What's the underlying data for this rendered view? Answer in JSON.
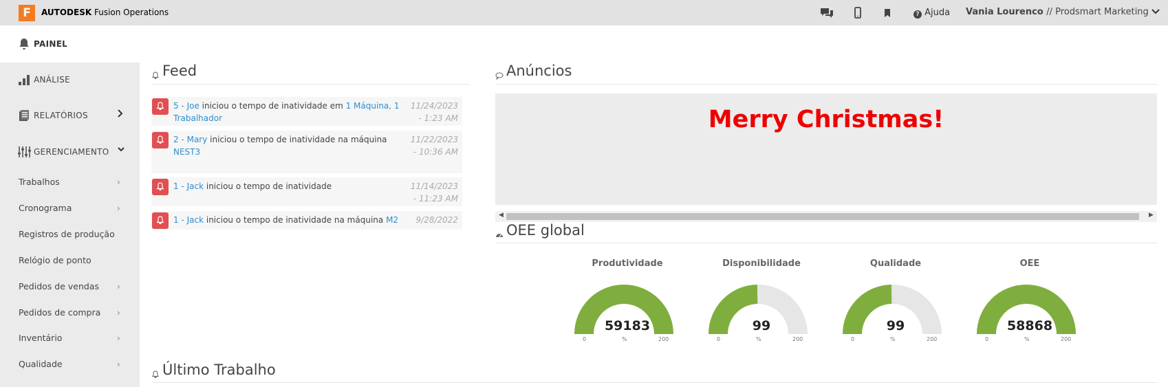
{
  "topbar": {
    "logo_letter": "F",
    "brand_bold": "AUTODESK",
    "brand_rest": "Fusion Operations",
    "help_label": "Ajuda",
    "user_name": "Vania Lourenco",
    "user_org": "// Prodsmart Marketing",
    "icons": [
      "chat-icon",
      "mobile-icon",
      "bookmark-icon",
      "help-icon",
      "chevron-down-icon"
    ]
  },
  "sidebar": {
    "painel": "PAINEL",
    "analise": "ANÁLISE",
    "relatorios": "RELATÓRIOS",
    "gerenciamento": "GERENCIAMENTO",
    "sub_items": [
      "Trabalhos",
      "Cronograma",
      "Registros de produção",
      "Relógio de ponto",
      "Pedidos de vendas",
      "Pedidos de compra",
      "Inventário",
      "Qualidade"
    ]
  },
  "feed": {
    "title": "Feed",
    "items": [
      {
        "link1": "5 - Joe",
        "text": " iniciou o tempo de inatividade em ",
        "link2": "1 Máquina, 1 Trabalhador",
        "date": "11/24/2023 - 1:23 AM"
      },
      {
        "link1": "2 - Mary",
        "text": " iniciou o tempo de inatividade na máquina ",
        "link2": "NEST3",
        "date": "11/22/2023 - 10:36 AM"
      },
      {
        "link1": "1 - Jack",
        "text": " iniciou o tempo de inatividade",
        "link2": "",
        "date": "11/14/2023 - 11:23 AM"
      },
      {
        "link1": "1 - Jack",
        "text": " iniciou o tempo de inatividade na máquina ",
        "link2": "M2",
        "date": "9/28/2022"
      }
    ]
  },
  "announcements": {
    "title": "Anúncios",
    "message": "Merry Christmas!",
    "message_color": "#ee0000"
  },
  "oee": {
    "title": "OEE global",
    "accent": "#7fae3e",
    "track": "#e6e6e6",
    "gauges": [
      {
        "label": "Produtividade",
        "value": "59183",
        "min": "0",
        "max": "200",
        "unit": "%",
        "fill": 1.0
      },
      {
        "label": "Disponibilidade",
        "value": "99",
        "min": "0",
        "max": "200",
        "unit": "%",
        "fill": 0.495
      },
      {
        "label": "Qualidade",
        "value": "99",
        "min": "0",
        "max": "200",
        "unit": "%",
        "fill": 0.495
      },
      {
        "label": "OEE",
        "value": "58868",
        "min": "0",
        "max": "200",
        "unit": "%",
        "fill": 1.0
      }
    ]
  },
  "last_job": {
    "title": "Último Trabalho"
  }
}
